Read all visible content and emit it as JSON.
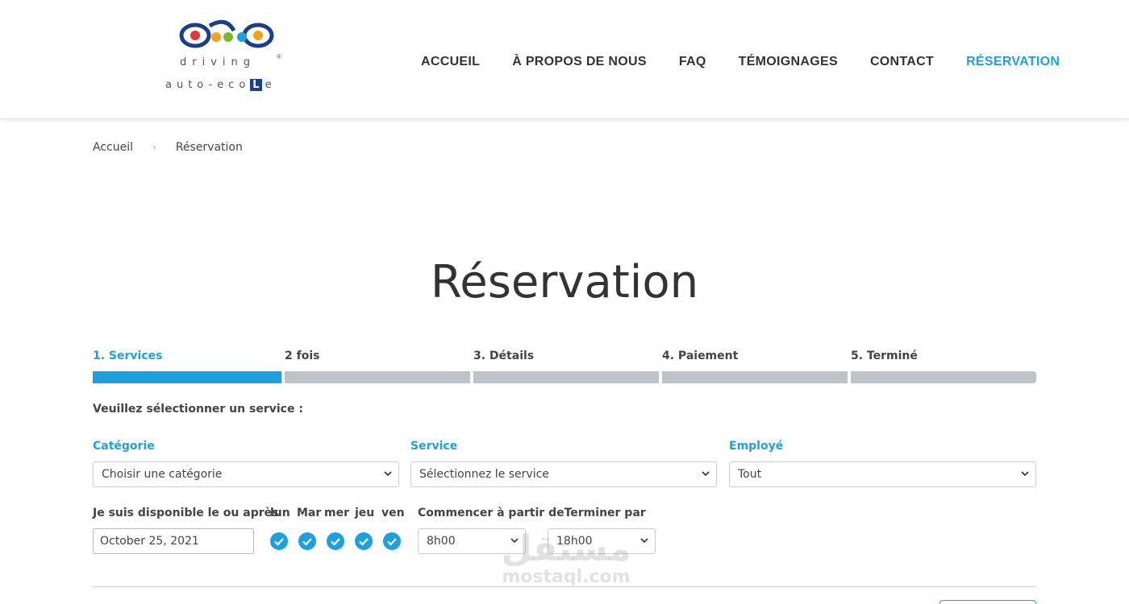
{
  "brand": {
    "line1": "driving",
    "registered": "®",
    "line2_prefix": "auto-eco",
    "line2_box": "L",
    "line2_suffix": "e"
  },
  "nav": {
    "items": [
      {
        "label": "ACCUEIL"
      },
      {
        "label": "À PROPOS DE NOUS"
      },
      {
        "label": "FAQ"
      },
      {
        "label": "TÉMOIGNAGES"
      },
      {
        "label": "CONTACT"
      },
      {
        "label": "RÉSERVATION"
      }
    ],
    "active_color": "#1ea0dc"
  },
  "breadcrumb": {
    "home": "Accueil",
    "separator": "›",
    "current": "Réservation"
  },
  "page": {
    "title": "Réservation"
  },
  "steps": [
    {
      "label": "1. Services",
      "active": true
    },
    {
      "label": "2 fois",
      "active": false
    },
    {
      "label": "3. Détails",
      "active": false
    },
    {
      "label": "4. Paiement",
      "active": false
    },
    {
      "label": "5. Terminé",
      "active": false
    }
  ],
  "form": {
    "prompt": "Veuillez sélectionner un service :",
    "category": {
      "label": "Catégorie",
      "value": "Choisir une catégorie"
    },
    "service": {
      "label": "Service",
      "value": "Sélectionnez le service"
    },
    "employee": {
      "label": "Employé",
      "value": "Tout"
    },
    "availability_label": "Je suis disponible le ou après",
    "date_value": "October 25, 2021",
    "days": [
      {
        "label": "lun",
        "checked": true
      },
      {
        "label": "Mar",
        "checked": true
      },
      {
        "label": "mer",
        "checked": true
      },
      {
        "label": "jeu",
        "checked": true
      },
      {
        "label": "ven",
        "checked": true
      }
    ],
    "start_label": "Commencer à partir de",
    "end_label": "Terminer par",
    "start_value": "8h00",
    "end_value": "18h00"
  },
  "watermark": {
    "arabic": "مستقل",
    "latin": "mostaql.com"
  },
  "colors": {
    "accent": "#1ea0dc",
    "inactive_step": "#bdc3c7",
    "text": "#333333"
  }
}
